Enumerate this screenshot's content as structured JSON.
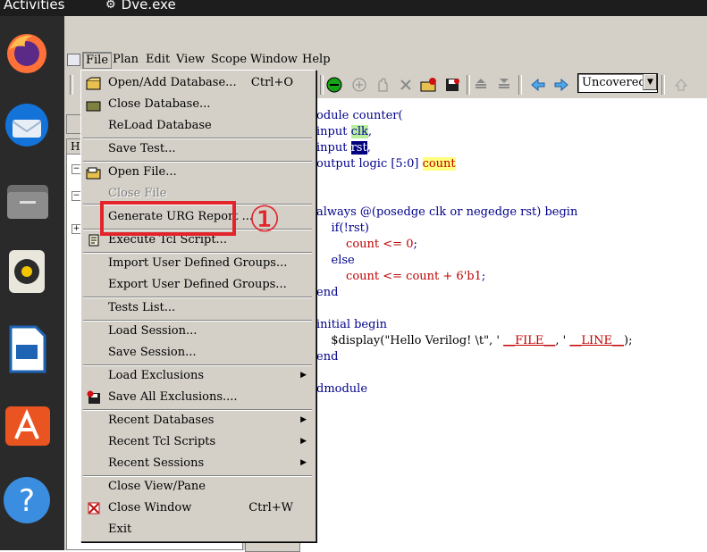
{
  "topbar": {
    "activities": "Activities",
    "app_name": "Dve.exe"
  },
  "dock": {
    "icons": [
      "firefox-icon",
      "thunderbird-icon",
      "files-icon",
      "rhythmbox-icon",
      "libreoffice-impress-icon",
      "app-center-icon",
      "help-icon"
    ]
  },
  "menubar": {
    "items": [
      {
        "label": "File",
        "accel": "F"
      },
      {
        "label": "Plan",
        "accel": "P"
      },
      {
        "label": "Edit",
        "accel": "E"
      },
      {
        "label": "View",
        "accel": "V"
      },
      {
        "label": "Scope",
        "accel": "S"
      },
      {
        "label": "Window",
        "accel": "W"
      },
      {
        "label": "Help",
        "accel": "H"
      }
    ]
  },
  "toolbar": {
    "coverage_select": "Uncovered"
  },
  "left_pane": {
    "header": "H"
  },
  "file_menu": {
    "items": [
      {
        "label": "Open/Add Database...",
        "shortcut": "Ctrl+O",
        "icon": "open-folder-icon"
      },
      {
        "label": "Close Database...",
        "icon": "close-folder-icon"
      },
      {
        "label": "ReLoad Database"
      },
      {
        "label": "Save Test..."
      },
      {
        "label": "Open File...",
        "icon": "open-file-icon"
      },
      {
        "label": "Close File",
        "disabled": true
      },
      {
        "label": "Generate URG Report ..."
      },
      {
        "label": "Execute Tcl Script...",
        "icon": "script-icon"
      },
      {
        "label": "Import User Defined Groups..."
      },
      {
        "label": "Export User Defined Groups..."
      },
      {
        "label": "Tests List..."
      },
      {
        "label": "Load Session..."
      },
      {
        "label": "Save Session..."
      },
      {
        "label": "Load Exclusions"
      },
      {
        "label": "Save All Exclusions....",
        "icon": "save-exclusions-icon"
      },
      {
        "label": "Recent Databases"
      },
      {
        "label": "Recent Tcl Scripts"
      },
      {
        "label": "Recent Sessions"
      },
      {
        "label": "Close View/Pane"
      },
      {
        "label": "Close Window",
        "shortcut": "Ctrl+W",
        "icon": "close-window-icon"
      },
      {
        "label": "Exit"
      }
    ]
  },
  "annotation": {
    "marker": "①"
  },
  "code": {
    "l1": "odule counter(",
    "l2a": "input ",
    "l2b": "clk",
    "l2c": ",",
    "l3a": "input ",
    "l3b": "rst",
    "l3c": ",",
    "l4a": "output logic [5:0] ",
    "l4b": "count",
    "l5": "always @(posedge clk or negedge rst) begin",
    "l6": "    if(!rst)",
    "l7a": "        count <= ",
    "l7b": "0",
    "l7c": ";",
    "l8": "    else",
    "l9a": "        count <= count + ",
    "l9b": "6'b1",
    "l9c": ";",
    "l10": "end",
    "l11": "initial begin",
    "l12a": "  $display(\"Hello Verilog! \\t\", ' ",
    "l12b": "__FILE__",
    "l12c": ", ' ",
    "l12d": "__LINE__",
    "l12e": ");",
    "l13": "end",
    "l14": "dmodule"
  },
  "colors": {
    "annotation_red": "#e3242b",
    "code_blue": "#00008b",
    "window_gray": "#d4d0c8"
  }
}
